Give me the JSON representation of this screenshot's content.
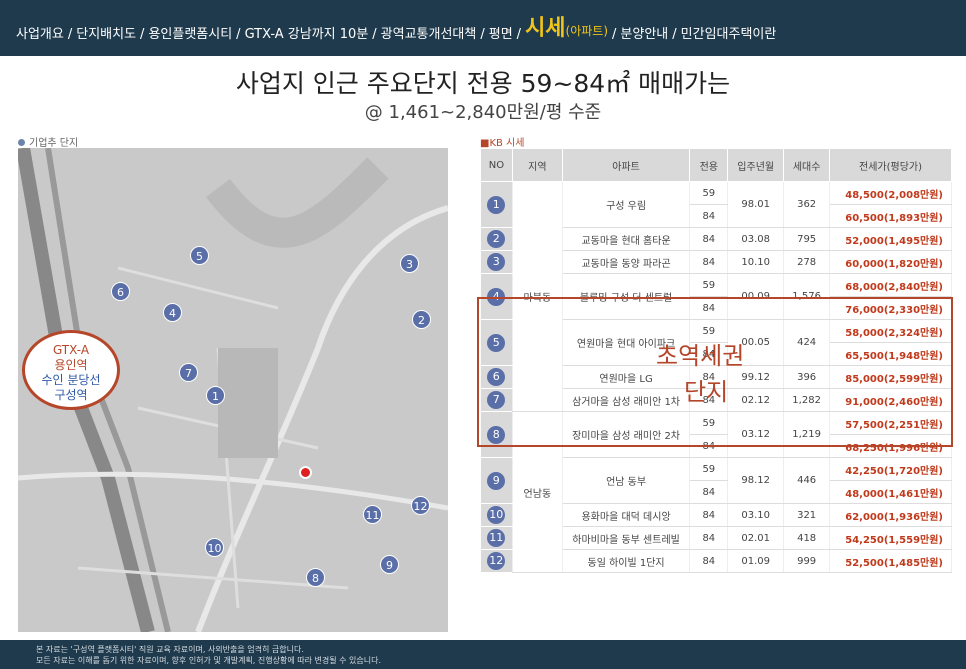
{
  "nav": {
    "items": [
      {
        "label": "사업개요"
      },
      {
        "label": "단지배치도"
      },
      {
        "label": "용인플랫폼시티"
      },
      {
        "label": "GTX-A 강남까지 10분"
      },
      {
        "label": "광역교통개선대책"
      },
      {
        "label": "평면"
      },
      {
        "label": "시세",
        "sub": "(아파트)",
        "active": true
      },
      {
        "label": "분양안내"
      },
      {
        "label": "민간임대주택이란"
      }
    ],
    "active_color": "#f0c419"
  },
  "headline": "사업지 인근 주요단지 전용 59~84㎡ 매매가는",
  "subline": "@ 1,461~2,840만원/평 수준",
  "map": {
    "caption": "기업추 단지",
    "callout": {
      "line1": "GTX-A",
      "line2": "용인역",
      "line3": "수인 분당선",
      "line4": "구성역"
    },
    "pins": [
      "1",
      "2",
      "3",
      "4",
      "5",
      "6",
      "7",
      "8",
      "9",
      "10",
      "11",
      "12"
    ]
  },
  "table": {
    "caption": "■KB 시세",
    "headers": [
      "NO",
      "지역",
      "아파트",
      "전용",
      "입주년월",
      "세대수",
      "전세가(평당가)"
    ],
    "regions": [
      "마북동",
      "언남동"
    ],
    "rows": [
      {
        "no": "1",
        "apt": "구성 우림",
        "size": "59",
        "date": "98.01",
        "units": "362",
        "price": "48,500(2,008만원)"
      },
      {
        "no": "",
        "apt": "",
        "size": "84",
        "date": "",
        "units": "",
        "price": "60,500(1,893만원)"
      },
      {
        "no": "2",
        "apt": "교동마을 현대 홈타운",
        "size": "84",
        "date": "03.08",
        "units": "795",
        "price": "52,000(1,495만원)"
      },
      {
        "no": "3",
        "apt": "교동마을 동양 파라곤",
        "size": "84",
        "date": "10.10",
        "units": "278",
        "price": "60,000(1,820만원)"
      },
      {
        "no": "4",
        "apt": "블루밍 구성 더 센트럴",
        "size": "59",
        "date": "00.09",
        "units": "1,576",
        "price": "68,000(2,840만원)"
      },
      {
        "no": "",
        "apt": "",
        "size": "84",
        "date": "",
        "units": "",
        "price": "76,000(2,330만원)"
      },
      {
        "no": "5",
        "apt": "연원마을 현대 아이파크",
        "size": "59",
        "date": "00.05",
        "units": "424",
        "price": "58,000(2,324만원)"
      },
      {
        "no": "",
        "apt": "",
        "size": "84",
        "date": "",
        "units": "",
        "price": "65,500(1,948만원)"
      },
      {
        "no": "6",
        "apt": "연원마을 LG",
        "size": "84",
        "date": "99.12",
        "units": "396",
        "price": "85,000(2,599만원)"
      },
      {
        "no": "7",
        "apt": "삼거마을 삼성 래미안 1차",
        "size": "84",
        "date": "02.12",
        "units": "1,282",
        "price": "91,000(2,460만원)"
      },
      {
        "no": "8",
        "apt": "장미마을 삼성 래미안 2차",
        "size": "59",
        "date": "03.12",
        "units": "1,219",
        "price": "57,500(2,251만원)"
      },
      {
        "no": "",
        "apt": "",
        "size": "84",
        "date": "",
        "units": "",
        "price": "68,250(1,996만원)"
      },
      {
        "no": "9",
        "apt": "언남 동부",
        "size": "59",
        "date": "98.12",
        "units": "446",
        "price": "42,250(1,720만원)"
      },
      {
        "no": "",
        "apt": "",
        "size": "84",
        "date": "",
        "units": "",
        "price": "48,000(1,461만원)"
      },
      {
        "no": "10",
        "apt": "용화마을 대덕 데시앙",
        "size": "84",
        "date": "03.10",
        "units": "321",
        "price": "62,000(1,936만원)"
      },
      {
        "no": "11",
        "apt": "하마비마을 동부 센트레빌",
        "size": "84",
        "date": "02.01",
        "units": "418",
        "price": "54,250(1,559만원)"
      },
      {
        "no": "12",
        "apt": "동일 하이빌 1단지",
        "size": "84",
        "date": "01.09",
        "units": "999",
        "price": "52,500(1,485만원)"
      }
    ],
    "overlay_line1": "초역세권",
    "overlay_line2": "단지",
    "accent_color": "#c0391b"
  },
  "footer": {
    "line1": "본 자료는 '구성역 플랫폼시티' 직원 교육 자료이며, 사외반출을 엄격히 금합니다.",
    "line2": "모든 자료는 이해를 돕기 위한 자료이며, 향후 인허가 및 개발계획, 진행상황에 따라 변경될 수 있습니다."
  }
}
